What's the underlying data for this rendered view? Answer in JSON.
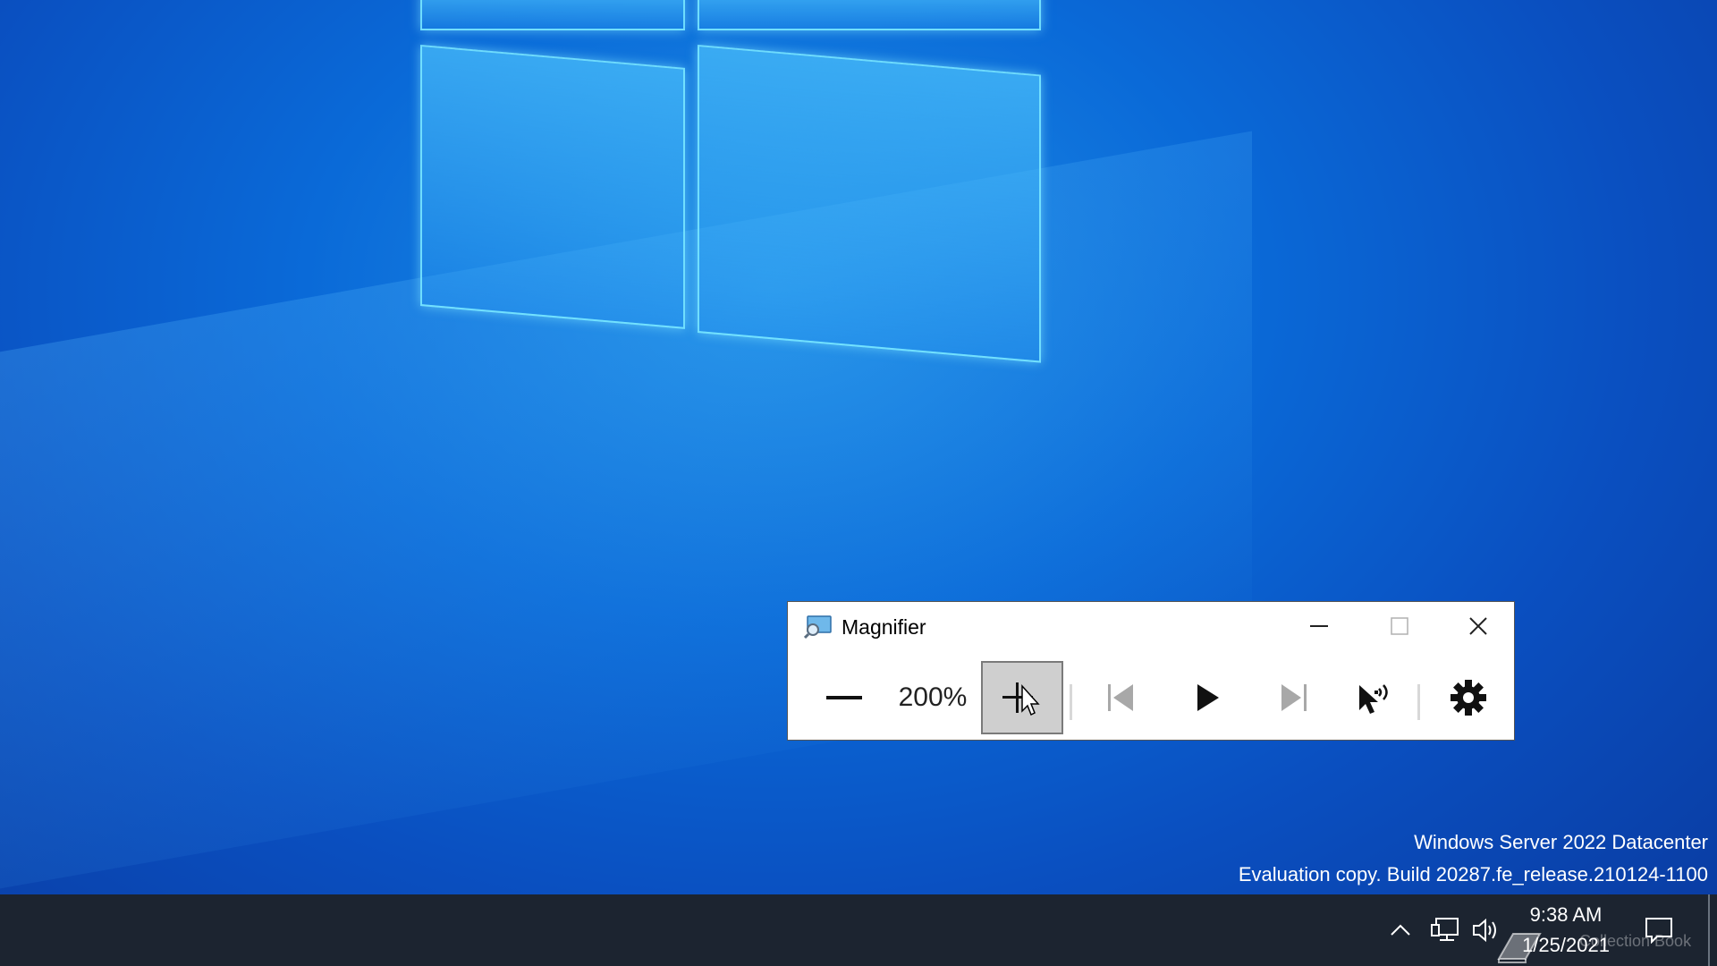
{
  "desktop": {
    "watermark_line1": "Windows Server 2022 Datacenter",
    "watermark_line2": "Evaluation copy. Build 20287.fe_release.210124-1100"
  },
  "magnifier": {
    "title": "Magnifier",
    "zoom_level": "200%",
    "icons": {
      "app": "magnifier-app-icon",
      "minimize": "minimize-icon",
      "maximize": "maximize-icon",
      "close": "close-icon",
      "zoom_out": "minus-icon",
      "zoom_in": "plus-icon",
      "previous": "previous-paragraph-icon",
      "play": "play-icon",
      "next": "next-paragraph-icon",
      "read_from_here": "read-from-here-icon",
      "settings": "gear-icon"
    }
  },
  "taskbar": {
    "time": "9:38 AM",
    "date": "1/25/2021",
    "overlay_text": "Collection Book",
    "icons": [
      "chevron-up-icon",
      "network-icon",
      "volume-icon",
      "notification-icon"
    ]
  },
  "colors": {
    "desktop_blue": "#0a6ad8",
    "taskbar": "#1c2430",
    "zoom_in_pressed": "#cfcfcf"
  }
}
